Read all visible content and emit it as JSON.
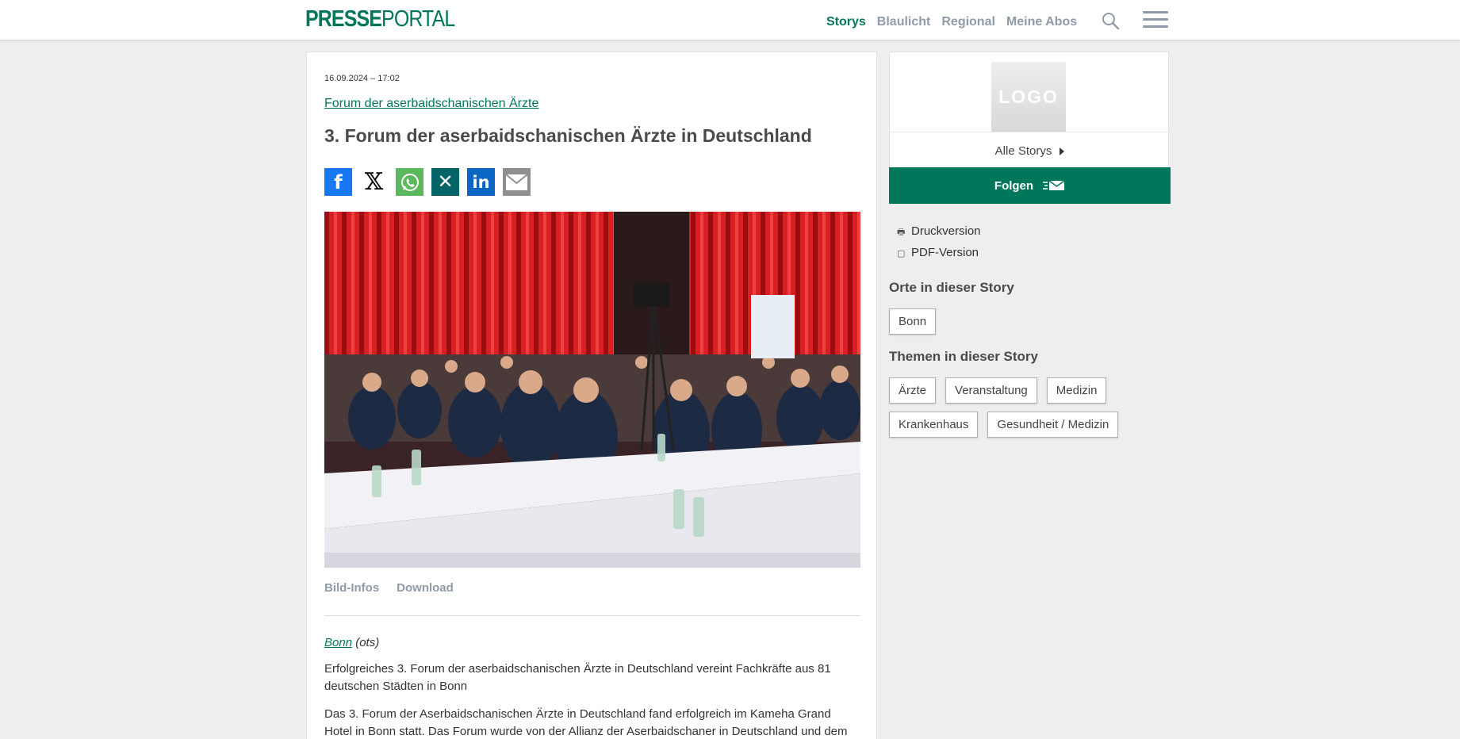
{
  "header": {
    "logo_a": "PRESSE",
    "logo_b": "PORTAL",
    "nav": [
      {
        "label": "Storys",
        "active": true
      },
      {
        "label": "Blaulicht",
        "active": false
      },
      {
        "label": "Regional",
        "active": false
      },
      {
        "label": "Meine Abos",
        "active": false
      }
    ],
    "icons": [
      "search-icon",
      "menu-icon"
    ]
  },
  "article": {
    "date": "16.09.2024 – 17:02",
    "company": "Forum der aserbaidschanischen Ärzte",
    "title": "3. Forum der aserbaidschanischen Ärzte in Deutschland",
    "share": [
      {
        "name": "facebook-icon",
        "glyph": "f"
      },
      {
        "name": "x-icon",
        "glyph": "𝕏"
      },
      {
        "name": "whatsapp-icon",
        "glyph": ""
      },
      {
        "name": "xing-icon",
        "glyph": "✕"
      },
      {
        "name": "linkedin-icon",
        "glyph": "in"
      },
      {
        "name": "email-icon",
        "glyph": ""
      }
    ],
    "image_tabs": [
      "Bild-Infos",
      "Download"
    ],
    "location": "Bonn",
    "source": "(ots)",
    "paragraphs": [
      "Erfolgreiches 3. Forum der aserbaidschanischen Ärzte in Deutschland vereint Fachkräfte aus 81 deutschen Städten in Bonn",
      "Das 3. Forum der Aserbaidschanischen Ärzte in Deutschland fand erfolgreich im Kameha Grand Hotel in Bonn statt. Das Forum wurde von der Allianz der Aserbaidschaner in Deutschland und dem"
    ]
  },
  "sidebar": {
    "logo_placeholder": "LOGO",
    "all_stories": "Alle Storys",
    "follow": "Folgen",
    "links": [
      {
        "label": "Druckversion",
        "icon": "print-icon"
      },
      {
        "label": "PDF-Version",
        "icon": "pdf-icon"
      }
    ],
    "places_heading": "Orte in dieser Story",
    "places": [
      "Bonn"
    ],
    "topics_heading": "Themen in dieser Story",
    "topics": [
      "Ärzte",
      "Veranstaltung",
      "Medizin",
      "Krankenhaus",
      "Gesundheit / Medizin"
    ]
  },
  "colors": {
    "brand": "#00775a",
    "nav_inactive": "#8f9ba8"
  }
}
